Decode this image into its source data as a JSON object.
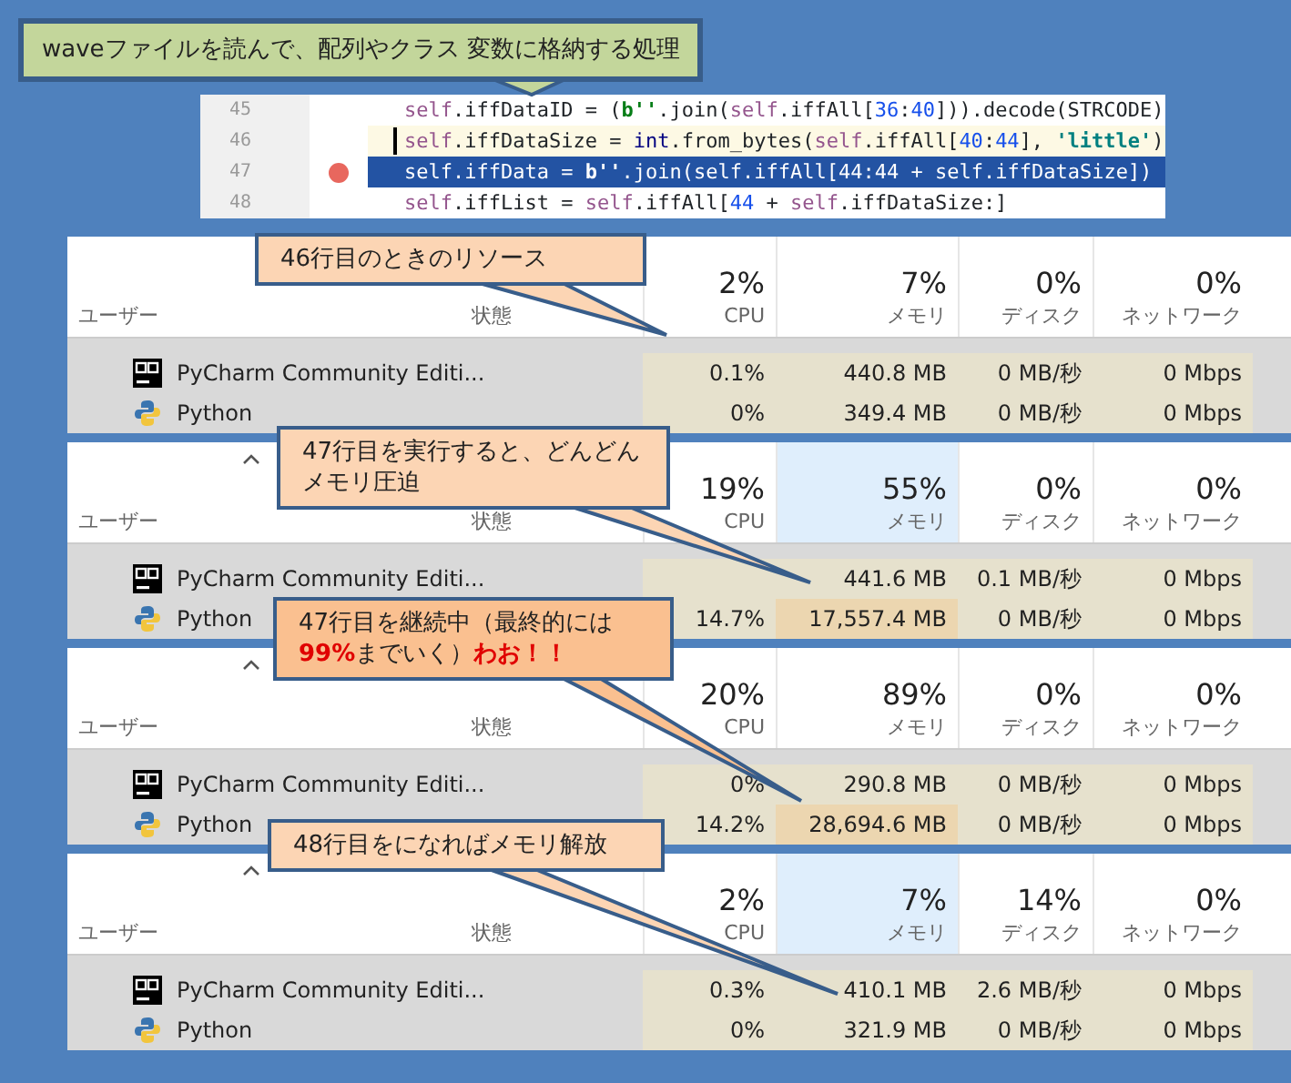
{
  "note": "waveファイルを読んで、配列やクラス 変数に格納する処理",
  "code": {
    "lines": [
      {
        "number": "45",
        "breakpoint": false,
        "selected": false,
        "highlighted": false,
        "caret": false,
        "tokens": [
          {
            "kind": "self",
            "text": "self"
          },
          {
            "kind": "plain",
            "text": ".iffDataID = ("
          },
          {
            "kind": "str",
            "text": "b''"
          },
          {
            "kind": "plain",
            "text": ".join("
          },
          {
            "kind": "self",
            "text": "self"
          },
          {
            "kind": "plain",
            "text": ".iffAll["
          },
          {
            "kind": "num",
            "text": "36"
          },
          {
            "kind": "plain",
            "text": ":"
          },
          {
            "kind": "num",
            "text": "40"
          },
          {
            "kind": "plain",
            "text": "])).decode(STRCODE)"
          }
        ]
      },
      {
        "number": "46",
        "breakpoint": false,
        "selected": false,
        "highlighted": true,
        "caret": true,
        "tokens": [
          {
            "kind": "self",
            "text": "self"
          },
          {
            "kind": "plain",
            "text": ".iffDataSize = "
          },
          {
            "kind": "builtin",
            "text": "int"
          },
          {
            "kind": "plain",
            "text": ".from_bytes("
          },
          {
            "kind": "self",
            "text": "self"
          },
          {
            "kind": "plain",
            "text": ".iffAll["
          },
          {
            "kind": "num",
            "text": "40"
          },
          {
            "kind": "plain",
            "text": ":"
          },
          {
            "kind": "num",
            "text": "44"
          },
          {
            "kind": "plain",
            "text": "], "
          },
          {
            "kind": "str2",
            "text": "'little'"
          },
          {
            "kind": "plain",
            "text": ")"
          }
        ]
      },
      {
        "number": "47",
        "breakpoint": true,
        "selected": true,
        "highlighted": false,
        "caret": false,
        "tokens": [
          {
            "kind": "self",
            "text": "self"
          },
          {
            "kind": "plain",
            "text": ".iffData = "
          },
          {
            "kind": "str",
            "text": "b''"
          },
          {
            "kind": "plain",
            "text": ".join("
          },
          {
            "kind": "self",
            "text": "self"
          },
          {
            "kind": "plain",
            "text": ".iffAll["
          },
          {
            "kind": "num",
            "text": "44"
          },
          {
            "kind": "plain",
            "text": ":"
          },
          {
            "kind": "num",
            "text": "44"
          },
          {
            "kind": "plain",
            "text": " + "
          },
          {
            "kind": "self",
            "text": "self"
          },
          {
            "kind": "plain",
            "text": ".iffDataSize])"
          }
        ]
      },
      {
        "number": "48",
        "breakpoint": false,
        "selected": false,
        "highlighted": false,
        "caret": false,
        "tokens": [
          {
            "kind": "self",
            "text": "self"
          },
          {
            "kind": "plain",
            "text": ".iffList = "
          },
          {
            "kind": "self",
            "text": "self"
          },
          {
            "kind": "plain",
            "text": ".iffAll["
          },
          {
            "kind": "num",
            "text": "44"
          },
          {
            "kind": "plain",
            "text": " + "
          },
          {
            "kind": "self",
            "text": "self"
          },
          {
            "kind": "plain",
            "text": ".iffDataSize:]"
          }
        ]
      }
    ]
  },
  "panels": [
    {
      "callout": {
        "lines": [
          "46行目のときのリソース"
        ],
        "color": "#fcd5b4"
      },
      "sort_indicator": false,
      "columns": [
        {
          "label": "ユーザー",
          "highlighted": false
        },
        {
          "label": "状態",
          "highlighted": false
        },
        {
          "percent": "2%",
          "label": "CPU",
          "highlighted": false
        },
        {
          "percent": "7%",
          "label": "メモリ",
          "highlighted": false
        },
        {
          "percent": "0%",
          "label": "ディスク",
          "highlighted": false
        },
        {
          "percent": "0%",
          "label": "ネットワーク",
          "highlighted": false
        }
      ],
      "rows": [
        {
          "kind": "pycharm",
          "cells": [
            {
              "text": "PyCharm Community Editi..."
            },
            {
              "text": ""
            },
            {
              "text": "0.1%",
              "hot": false
            },
            {
              "text": "440.8 MB",
              "hot": false
            },
            {
              "text": "0 MB/秒",
              "hot": false
            },
            {
              "text": "0 Mbps",
              "hot": false
            }
          ]
        },
        {
          "kind": "python",
          "cells": [
            {
              "text": "Python"
            },
            {
              "text": ""
            },
            {
              "text": "0%",
              "hot": false
            },
            {
              "text": "349.4 MB",
              "hot": false
            },
            {
              "text": "0 MB/秒",
              "hot": false
            },
            {
              "text": "0 Mbps",
              "hot": false
            }
          ]
        }
      ]
    },
    {
      "callout": {
        "lines": [
          "47行目を実行すると、どんどん",
          "メモリ圧迫"
        ],
        "color": "#fcd5b4"
      },
      "sort_indicator": true,
      "columns": [
        {
          "label": "ユーザー",
          "highlighted": false
        },
        {
          "label": "状態",
          "highlighted": false
        },
        {
          "percent": "19%",
          "label": "CPU",
          "highlighted": false
        },
        {
          "percent": "55%",
          "label": "メモリ",
          "highlighted": true
        },
        {
          "percent": "0%",
          "label": "ディスク",
          "highlighted": false
        },
        {
          "percent": "0%",
          "label": "ネットワーク",
          "highlighted": false
        }
      ],
      "rows": [
        {
          "kind": "pycharm",
          "cells": [
            {
              "text": "PyCharm Community Editi..."
            },
            {
              "text": ""
            },
            {
              "text": "",
              "hot": false
            },
            {
              "text": "441.6 MB",
              "hot": false
            },
            {
              "text": "0.1 MB/秒",
              "hot": false
            },
            {
              "text": "0 Mbps",
              "hot": false
            }
          ]
        },
        {
          "kind": "python",
          "cells": [
            {
              "text": "Python"
            },
            {
              "text": ""
            },
            {
              "text": "14.7%",
              "hot": false
            },
            {
              "text": "17,557.4 MB",
              "hot": true
            },
            {
              "text": "0 MB/秒",
              "hot": false
            },
            {
              "text": "0 Mbps",
              "hot": false
            }
          ]
        }
      ]
    },
    {
      "callout": {
        "lines": [
          "47行目を継続中（最終的には",
          "**99%**までいく）**わお！！**"
        ],
        "color": "#fac090"
      },
      "sort_indicator": true,
      "columns": [
        {
          "label": "ユーザー",
          "highlighted": false
        },
        {
          "label": "状態",
          "highlighted": false
        },
        {
          "percent": "20%",
          "label": "CPU",
          "highlighted": false
        },
        {
          "percent": "89%",
          "label": "メモリ",
          "highlighted": false
        },
        {
          "percent": "0%",
          "label": "ディスク",
          "highlighted": false
        },
        {
          "percent": "0%",
          "label": "ネットワーク",
          "highlighted": false
        }
      ],
      "rows": [
        {
          "kind": "pycharm",
          "cells": [
            {
              "text": "PyCharm Community Editi..."
            },
            {
              "text": ""
            },
            {
              "text": "0%",
              "hot": false
            },
            {
              "text": "290.8 MB",
              "hot": false
            },
            {
              "text": "0 MB/秒",
              "hot": false
            },
            {
              "text": "0 Mbps",
              "hot": false
            }
          ]
        },
        {
          "kind": "python",
          "cells": [
            {
              "text": "Python"
            },
            {
              "text": ""
            },
            {
              "text": "14.2%",
              "hot": false
            },
            {
              "text": "28,694.6 MB",
              "hot": true
            },
            {
              "text": "0 MB/秒",
              "hot": false
            },
            {
              "text": "0 Mbps",
              "hot": false
            }
          ]
        }
      ]
    },
    {
      "callout": {
        "lines": [
          "48行目をになればメモリ解放"
        ],
        "color": "#fcd5b4"
      },
      "sort_indicator": true,
      "columns": [
        {
          "label": "ユーザー",
          "highlighted": false
        },
        {
          "label": "状態",
          "highlighted": false
        },
        {
          "percent": "2%",
          "label": "CPU",
          "highlighted": false
        },
        {
          "percent": "7%",
          "label": "メモリ",
          "highlighted": true
        },
        {
          "percent": "14%",
          "label": "ディスク",
          "highlighted": false
        },
        {
          "percent": "0%",
          "label": "ネットワーク",
          "highlighted": false
        }
      ],
      "rows": [
        {
          "kind": "pycharm",
          "cells": [
            {
              "text": "PyCharm Community Editi..."
            },
            {
              "text": ""
            },
            {
              "text": "0.3%",
              "hot": false
            },
            {
              "text": "410.1 MB",
              "hot": false
            },
            {
              "text": "2.6 MB/秒",
              "hot": false
            },
            {
              "text": "0 Mbps",
              "hot": false
            }
          ]
        },
        {
          "kind": "python",
          "cells": [
            {
              "text": "Python"
            },
            {
              "text": ""
            },
            {
              "text": "0%",
              "hot": false
            },
            {
              "text": "321.9 MB",
              "hot": false
            },
            {
              "text": "0 MB/秒",
              "hot": false
            },
            {
              "text": "0 Mbps",
              "hot": false
            }
          ]
        }
      ]
    }
  ]
}
